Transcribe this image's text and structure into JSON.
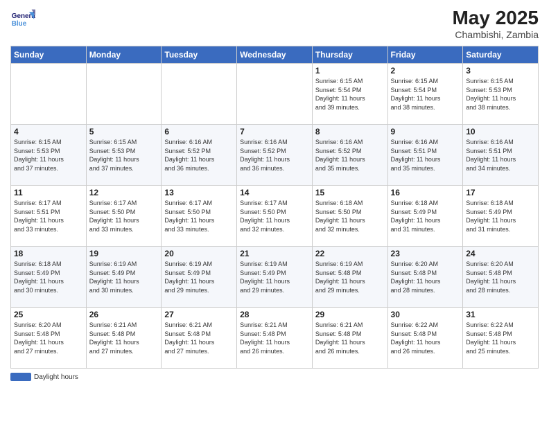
{
  "header": {
    "logo": {
      "line1": "General",
      "line2": "Blue"
    },
    "title": "May 2025",
    "location": "Chambishi, Zambia"
  },
  "days_of_week": [
    "Sunday",
    "Monday",
    "Tuesday",
    "Wednesday",
    "Thursday",
    "Friday",
    "Saturday"
  ],
  "weeks": [
    [
      {
        "day": "",
        "info": ""
      },
      {
        "day": "",
        "info": ""
      },
      {
        "day": "",
        "info": ""
      },
      {
        "day": "",
        "info": ""
      },
      {
        "day": "1",
        "info": "Sunrise: 6:15 AM\nSunset: 5:54 PM\nDaylight: 11 hours\nand 39 minutes."
      },
      {
        "day": "2",
        "info": "Sunrise: 6:15 AM\nSunset: 5:54 PM\nDaylight: 11 hours\nand 38 minutes."
      },
      {
        "day": "3",
        "info": "Sunrise: 6:15 AM\nSunset: 5:53 PM\nDaylight: 11 hours\nand 38 minutes."
      }
    ],
    [
      {
        "day": "4",
        "info": "Sunrise: 6:15 AM\nSunset: 5:53 PM\nDaylight: 11 hours\nand 37 minutes."
      },
      {
        "day": "5",
        "info": "Sunrise: 6:15 AM\nSunset: 5:53 PM\nDaylight: 11 hours\nand 37 minutes."
      },
      {
        "day": "6",
        "info": "Sunrise: 6:16 AM\nSunset: 5:52 PM\nDaylight: 11 hours\nand 36 minutes."
      },
      {
        "day": "7",
        "info": "Sunrise: 6:16 AM\nSunset: 5:52 PM\nDaylight: 11 hours\nand 36 minutes."
      },
      {
        "day": "8",
        "info": "Sunrise: 6:16 AM\nSunset: 5:52 PM\nDaylight: 11 hours\nand 35 minutes."
      },
      {
        "day": "9",
        "info": "Sunrise: 6:16 AM\nSunset: 5:51 PM\nDaylight: 11 hours\nand 35 minutes."
      },
      {
        "day": "10",
        "info": "Sunrise: 6:16 AM\nSunset: 5:51 PM\nDaylight: 11 hours\nand 34 minutes."
      }
    ],
    [
      {
        "day": "11",
        "info": "Sunrise: 6:17 AM\nSunset: 5:51 PM\nDaylight: 11 hours\nand 33 minutes."
      },
      {
        "day": "12",
        "info": "Sunrise: 6:17 AM\nSunset: 5:50 PM\nDaylight: 11 hours\nand 33 minutes."
      },
      {
        "day": "13",
        "info": "Sunrise: 6:17 AM\nSunset: 5:50 PM\nDaylight: 11 hours\nand 33 minutes."
      },
      {
        "day": "14",
        "info": "Sunrise: 6:17 AM\nSunset: 5:50 PM\nDaylight: 11 hours\nand 32 minutes."
      },
      {
        "day": "15",
        "info": "Sunrise: 6:18 AM\nSunset: 5:50 PM\nDaylight: 11 hours\nand 32 minutes."
      },
      {
        "day": "16",
        "info": "Sunrise: 6:18 AM\nSunset: 5:49 PM\nDaylight: 11 hours\nand 31 minutes."
      },
      {
        "day": "17",
        "info": "Sunrise: 6:18 AM\nSunset: 5:49 PM\nDaylight: 11 hours\nand 31 minutes."
      }
    ],
    [
      {
        "day": "18",
        "info": "Sunrise: 6:18 AM\nSunset: 5:49 PM\nDaylight: 11 hours\nand 30 minutes."
      },
      {
        "day": "19",
        "info": "Sunrise: 6:19 AM\nSunset: 5:49 PM\nDaylight: 11 hours\nand 30 minutes."
      },
      {
        "day": "20",
        "info": "Sunrise: 6:19 AM\nSunset: 5:49 PM\nDaylight: 11 hours\nand 29 minutes."
      },
      {
        "day": "21",
        "info": "Sunrise: 6:19 AM\nSunset: 5:49 PM\nDaylight: 11 hours\nand 29 minutes."
      },
      {
        "day": "22",
        "info": "Sunrise: 6:19 AM\nSunset: 5:48 PM\nDaylight: 11 hours\nand 29 minutes."
      },
      {
        "day": "23",
        "info": "Sunrise: 6:20 AM\nSunset: 5:48 PM\nDaylight: 11 hours\nand 28 minutes."
      },
      {
        "day": "24",
        "info": "Sunrise: 6:20 AM\nSunset: 5:48 PM\nDaylight: 11 hours\nand 28 minutes."
      }
    ],
    [
      {
        "day": "25",
        "info": "Sunrise: 6:20 AM\nSunset: 5:48 PM\nDaylight: 11 hours\nand 27 minutes."
      },
      {
        "day": "26",
        "info": "Sunrise: 6:21 AM\nSunset: 5:48 PM\nDaylight: 11 hours\nand 27 minutes."
      },
      {
        "day": "27",
        "info": "Sunrise: 6:21 AM\nSunset: 5:48 PM\nDaylight: 11 hours\nand 27 minutes."
      },
      {
        "day": "28",
        "info": "Sunrise: 6:21 AM\nSunset: 5:48 PM\nDaylight: 11 hours\nand 26 minutes."
      },
      {
        "day": "29",
        "info": "Sunrise: 6:21 AM\nSunset: 5:48 PM\nDaylight: 11 hours\nand 26 minutes."
      },
      {
        "day": "30",
        "info": "Sunrise: 6:22 AM\nSunset: 5:48 PM\nDaylight: 11 hours\nand 26 minutes."
      },
      {
        "day": "31",
        "info": "Sunrise: 6:22 AM\nSunset: 5:48 PM\nDaylight: 11 hours\nand 25 minutes."
      }
    ]
  ],
  "footer": {
    "legend_label": "Daylight hours"
  }
}
